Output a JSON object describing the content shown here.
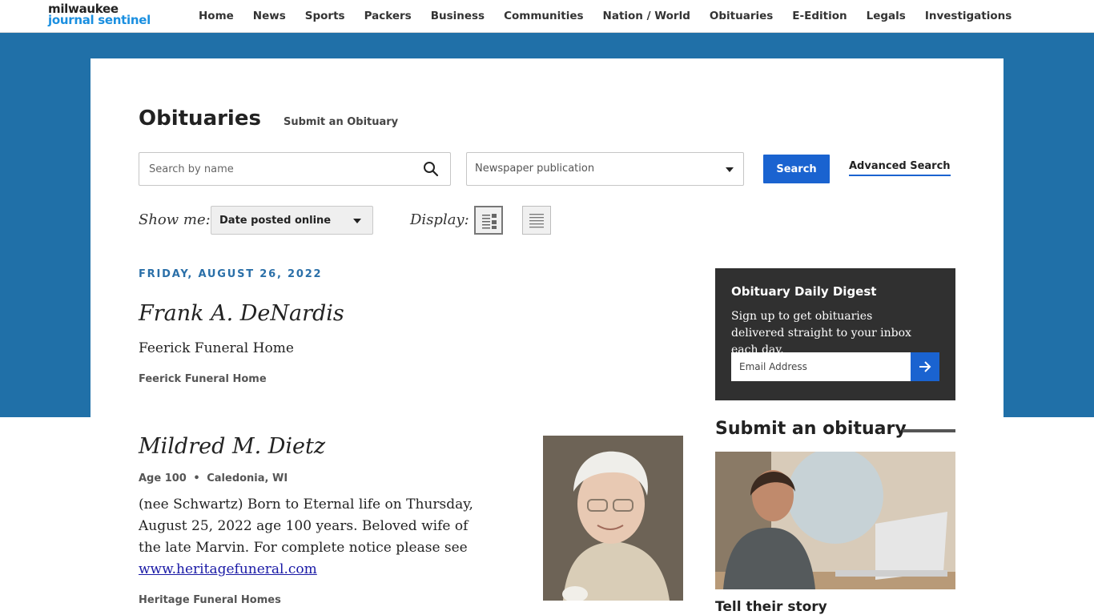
{
  "brand": {
    "line1": "milwaukee",
    "line2": "journal sentinel"
  },
  "nav": {
    "items": [
      "Home",
      "News",
      "Sports",
      "Packers",
      "Business",
      "Communities",
      "Nation / World",
      "Obituaries",
      "E-Edition",
      "Legals",
      "Investigations"
    ]
  },
  "header": {
    "title": "Obituaries",
    "submit_link": "Submit an Obituary"
  },
  "filters": {
    "search_placeholder": "Search by name",
    "search_value": "",
    "publication_placeholder": "Newspaper publication",
    "search_button": "Search",
    "advanced_link": "Advanced Search",
    "show_me_label": "Show me:",
    "show_me_value": "Date posted online",
    "display_label": "Display:"
  },
  "date_heading": "FRIDAY, AUGUST 26, 2022",
  "obituaries": [
    {
      "name": "Frank A. DeNardis",
      "subtitle": "Feerick Funeral Home",
      "funeral_home": "Feerick Funeral Home"
    },
    {
      "name": "Mildred M. Dietz",
      "age": "Age 100",
      "location": "Caledonia, WI",
      "meta_separator": "•",
      "body": "(nee Schwartz) Born to Eternal life on Thursday, August 25, 2022 age 100 years. Beloved wife of the late Marvin. For complete notice please see",
      "link": "www.heritagefuneral.com",
      "funeral_home": "Heritage Funeral Homes"
    }
  ],
  "digest": {
    "title": "Obituary Daily Digest",
    "text": "Sign up to get obituaries delivered straight to your inbox each day.",
    "email_placeholder": "Email Address"
  },
  "submit_section": {
    "heading": "Submit an obituary",
    "promo_caption": "Tell their story"
  },
  "colors": {
    "band": "#2070a8",
    "accent": "#1a63d0",
    "date_heading": "#2a6fa8",
    "digest_bg": "#303030"
  },
  "icons": [
    "search-icon",
    "chevron-down-icon",
    "list-view-icon",
    "compact-view-icon",
    "arrow-right-icon"
  ]
}
